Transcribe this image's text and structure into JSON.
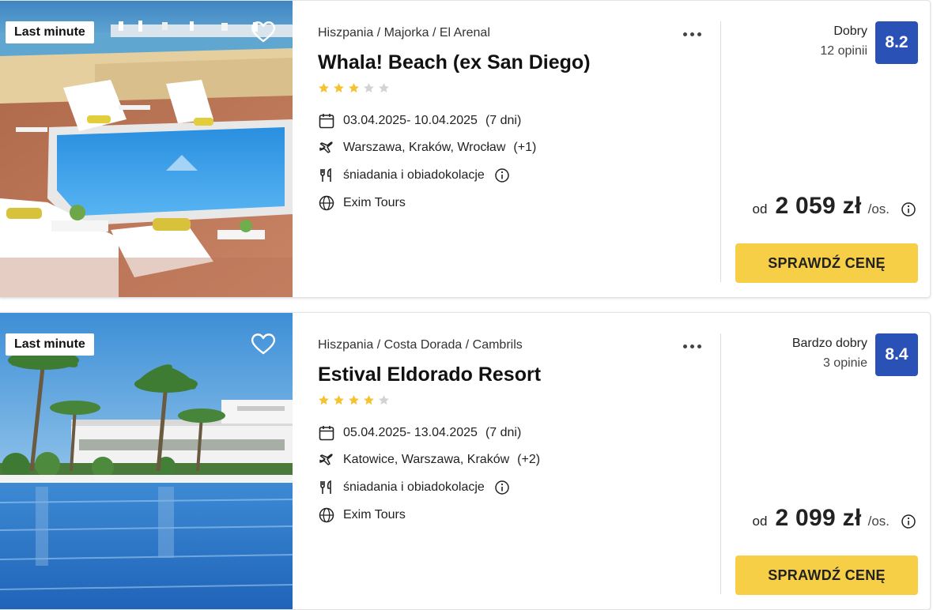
{
  "colors": {
    "rating_badge": "#2a51b5",
    "cta": "#f7cf46",
    "star_filled": "#f5c332",
    "star_empty": "#d3d3d3"
  },
  "offers": [
    {
      "badge": "Last minute",
      "breadcrumb": "Hiszpania / Majorka / El Arenal",
      "title": "Whala! Beach (ex San Diego)",
      "stars": 3,
      "dates": "03.04.2025- 10.04.2025",
      "duration": "(7 dni)",
      "departures": "Warszawa, Kraków, Wrocław",
      "departures_more": "(+1)",
      "board": "śniadania i obiadokolacje",
      "operator": "Exim Tours",
      "rating_label": "Dobry",
      "rating_count": "12 opinii",
      "rating_score": "8.2",
      "price_prefix": "od",
      "price": "2 059 zł",
      "price_suffix": "/os.",
      "cta": "SPRAWDŹ CENĘ",
      "icons": [
        "heart-outline-icon",
        "more-dots-icon",
        "star-icon",
        "calendar-icon",
        "plane-icon",
        "cutlery-icon",
        "info-icon",
        "globe-icon"
      ]
    },
    {
      "badge": "Last minute",
      "breadcrumb": "Hiszpania / Costa Dorada / Cambrils",
      "title": "Estival Eldorado Resort",
      "stars": 4,
      "dates": "05.04.2025- 13.04.2025",
      "duration": "(7 dni)",
      "departures": "Katowice, Warszawa, Kraków",
      "departures_more": "(+2)",
      "board": "śniadania i obiadokolacje",
      "operator": "Exim Tours",
      "rating_label": "Bardzo dobry",
      "rating_count": "3 opinie",
      "rating_score": "8.4",
      "price_prefix": "od",
      "price": "2 099 zł",
      "price_suffix": "/os.",
      "cta": "SPRAWDŹ CENĘ",
      "icons": [
        "heart-outline-icon",
        "more-dots-icon",
        "star-icon",
        "calendar-icon",
        "plane-icon",
        "cutlery-icon",
        "info-icon",
        "globe-icon"
      ]
    }
  ]
}
